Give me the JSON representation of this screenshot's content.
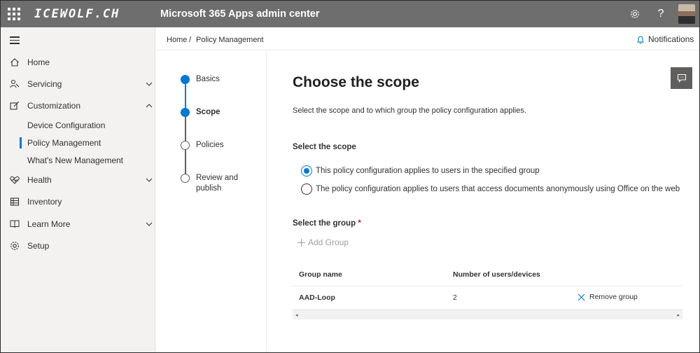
{
  "header": {
    "brand": "ICEWOLF.CH",
    "title": "Microsoft 365 Apps admin center",
    "settings_icon": "gear-icon",
    "help_label": "?"
  },
  "sidebar": {
    "items": [
      {
        "label": "Home",
        "icon": "home-icon"
      },
      {
        "label": "Servicing",
        "icon": "servicing-icon",
        "expandable": true
      },
      {
        "label": "Customization",
        "icon": "customization-icon",
        "expanded": true
      },
      {
        "label": "Health",
        "icon": "heart-icon",
        "expandable": true
      },
      {
        "label": "Inventory",
        "icon": "inventory-icon"
      },
      {
        "label": "Learn More",
        "icon": "book-icon",
        "expandable": true
      },
      {
        "label": "Setup",
        "icon": "gear-icon"
      }
    ],
    "customization_children": [
      {
        "label": "Device Configuration"
      },
      {
        "label": "Policy Management",
        "active": true
      },
      {
        "label": "What's New Management"
      }
    ]
  },
  "breadcrumb": {
    "home": "Home",
    "separator": "/",
    "current": "Policy Management",
    "notifications": "Notifications"
  },
  "stepper": {
    "steps": [
      {
        "label": "Basics",
        "state": "done"
      },
      {
        "label": "Scope",
        "state": "current"
      },
      {
        "label": "Policies",
        "state": "pending"
      },
      {
        "label": "Review and publish",
        "state": "pending"
      }
    ]
  },
  "main": {
    "title": "Choose the scope",
    "description": "Select the scope and to which group the policy configuration applies.",
    "scope_heading": "Select the scope",
    "scope_options": [
      {
        "label": "This policy configuration applies to users in the specified group",
        "checked": true
      },
      {
        "label": "The policy configuration applies to users that access documents anonymously using Office on the web",
        "checked": false
      }
    ],
    "group_heading": "Select the group",
    "required_mark": "*",
    "add_group": "Add Group",
    "table": {
      "columns": [
        "Group name",
        "Number of users/devices"
      ],
      "rows": [
        {
          "name": "AAD-Loop",
          "count": "2",
          "action": "Remove group"
        }
      ]
    }
  },
  "colors": {
    "accent": "#0078d4",
    "topbar": "#6e6e6e",
    "sidebar_bg": "#f3f2f1"
  }
}
